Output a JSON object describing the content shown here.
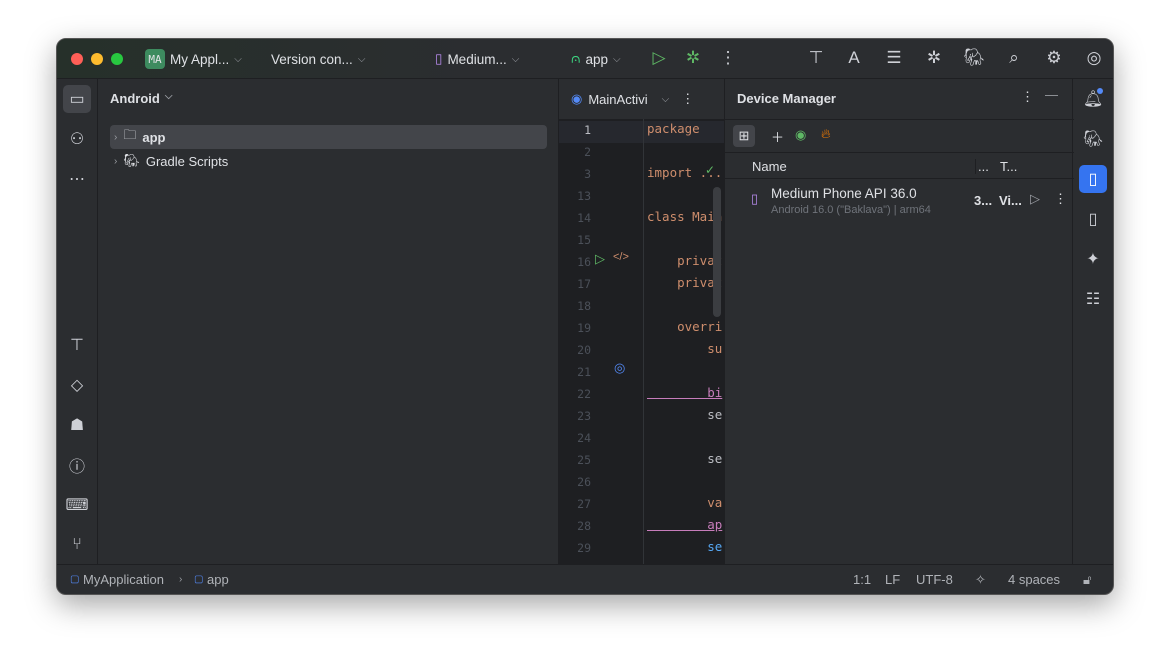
{
  "titlebar": {
    "project_badge": "MA",
    "project": "My Appl...",
    "vcs": "Version con...",
    "device": "Medium...",
    "run_config": "app"
  },
  "project_panel": {
    "view": "Android",
    "tree": [
      {
        "label": "app"
      },
      {
        "label": "Gradle Scripts"
      }
    ]
  },
  "editor": {
    "tab": "MainActivi",
    "lines": [
      {
        "n": "1",
        "code": "package",
        "cls": "kw"
      },
      {
        "n": "2",
        "code": ""
      },
      {
        "n": "3",
        "code": "import ...",
        "cls": "kw"
      },
      {
        "n": "13",
        "code": ""
      },
      {
        "n": "14",
        "code": "class Main",
        "cls": "kw"
      },
      {
        "n": "15",
        "code": ""
      },
      {
        "n": "16",
        "code": "    privat",
        "cls": "kw"
      },
      {
        "n": "17",
        "code": "    privat",
        "cls": "kw"
      },
      {
        "n": "18",
        "code": ""
      },
      {
        "n": "19",
        "code": "    overri",
        "cls": "kw"
      },
      {
        "n": "20",
        "code": "        su",
        "cls": "kw"
      },
      {
        "n": "21",
        "code": ""
      },
      {
        "n": "22",
        "code": "        bi",
        "cls": "pu"
      },
      {
        "n": "23",
        "code": "        se",
        "cls": "pl"
      },
      {
        "n": "24",
        "code": ""
      },
      {
        "n": "25",
        "code": "        se",
        "cls": "pl"
      },
      {
        "n": "26",
        "code": ""
      },
      {
        "n": "27",
        "code": "        va",
        "cls": "kw"
      },
      {
        "n": "28",
        "code": "        ap",
        "cls": "pu"
      },
      {
        "n": "29",
        "code": "        se",
        "cls": "bl"
      }
    ]
  },
  "device_manager": {
    "title": "Device Manager",
    "columns": [
      "Name",
      "...",
      "T..."
    ],
    "devices": [
      {
        "name": "Medium Phone API 36.0",
        "detail": "Android 16.0 (\"Baklava\") | arm64",
        "api": "3...",
        "type": "Vi..."
      }
    ]
  },
  "status": {
    "breadcrumb": [
      "MyApplication",
      "app"
    ],
    "position": "1:1",
    "line_sep": "LF",
    "encoding": "UTF-8",
    "indent": "4 spaces"
  }
}
